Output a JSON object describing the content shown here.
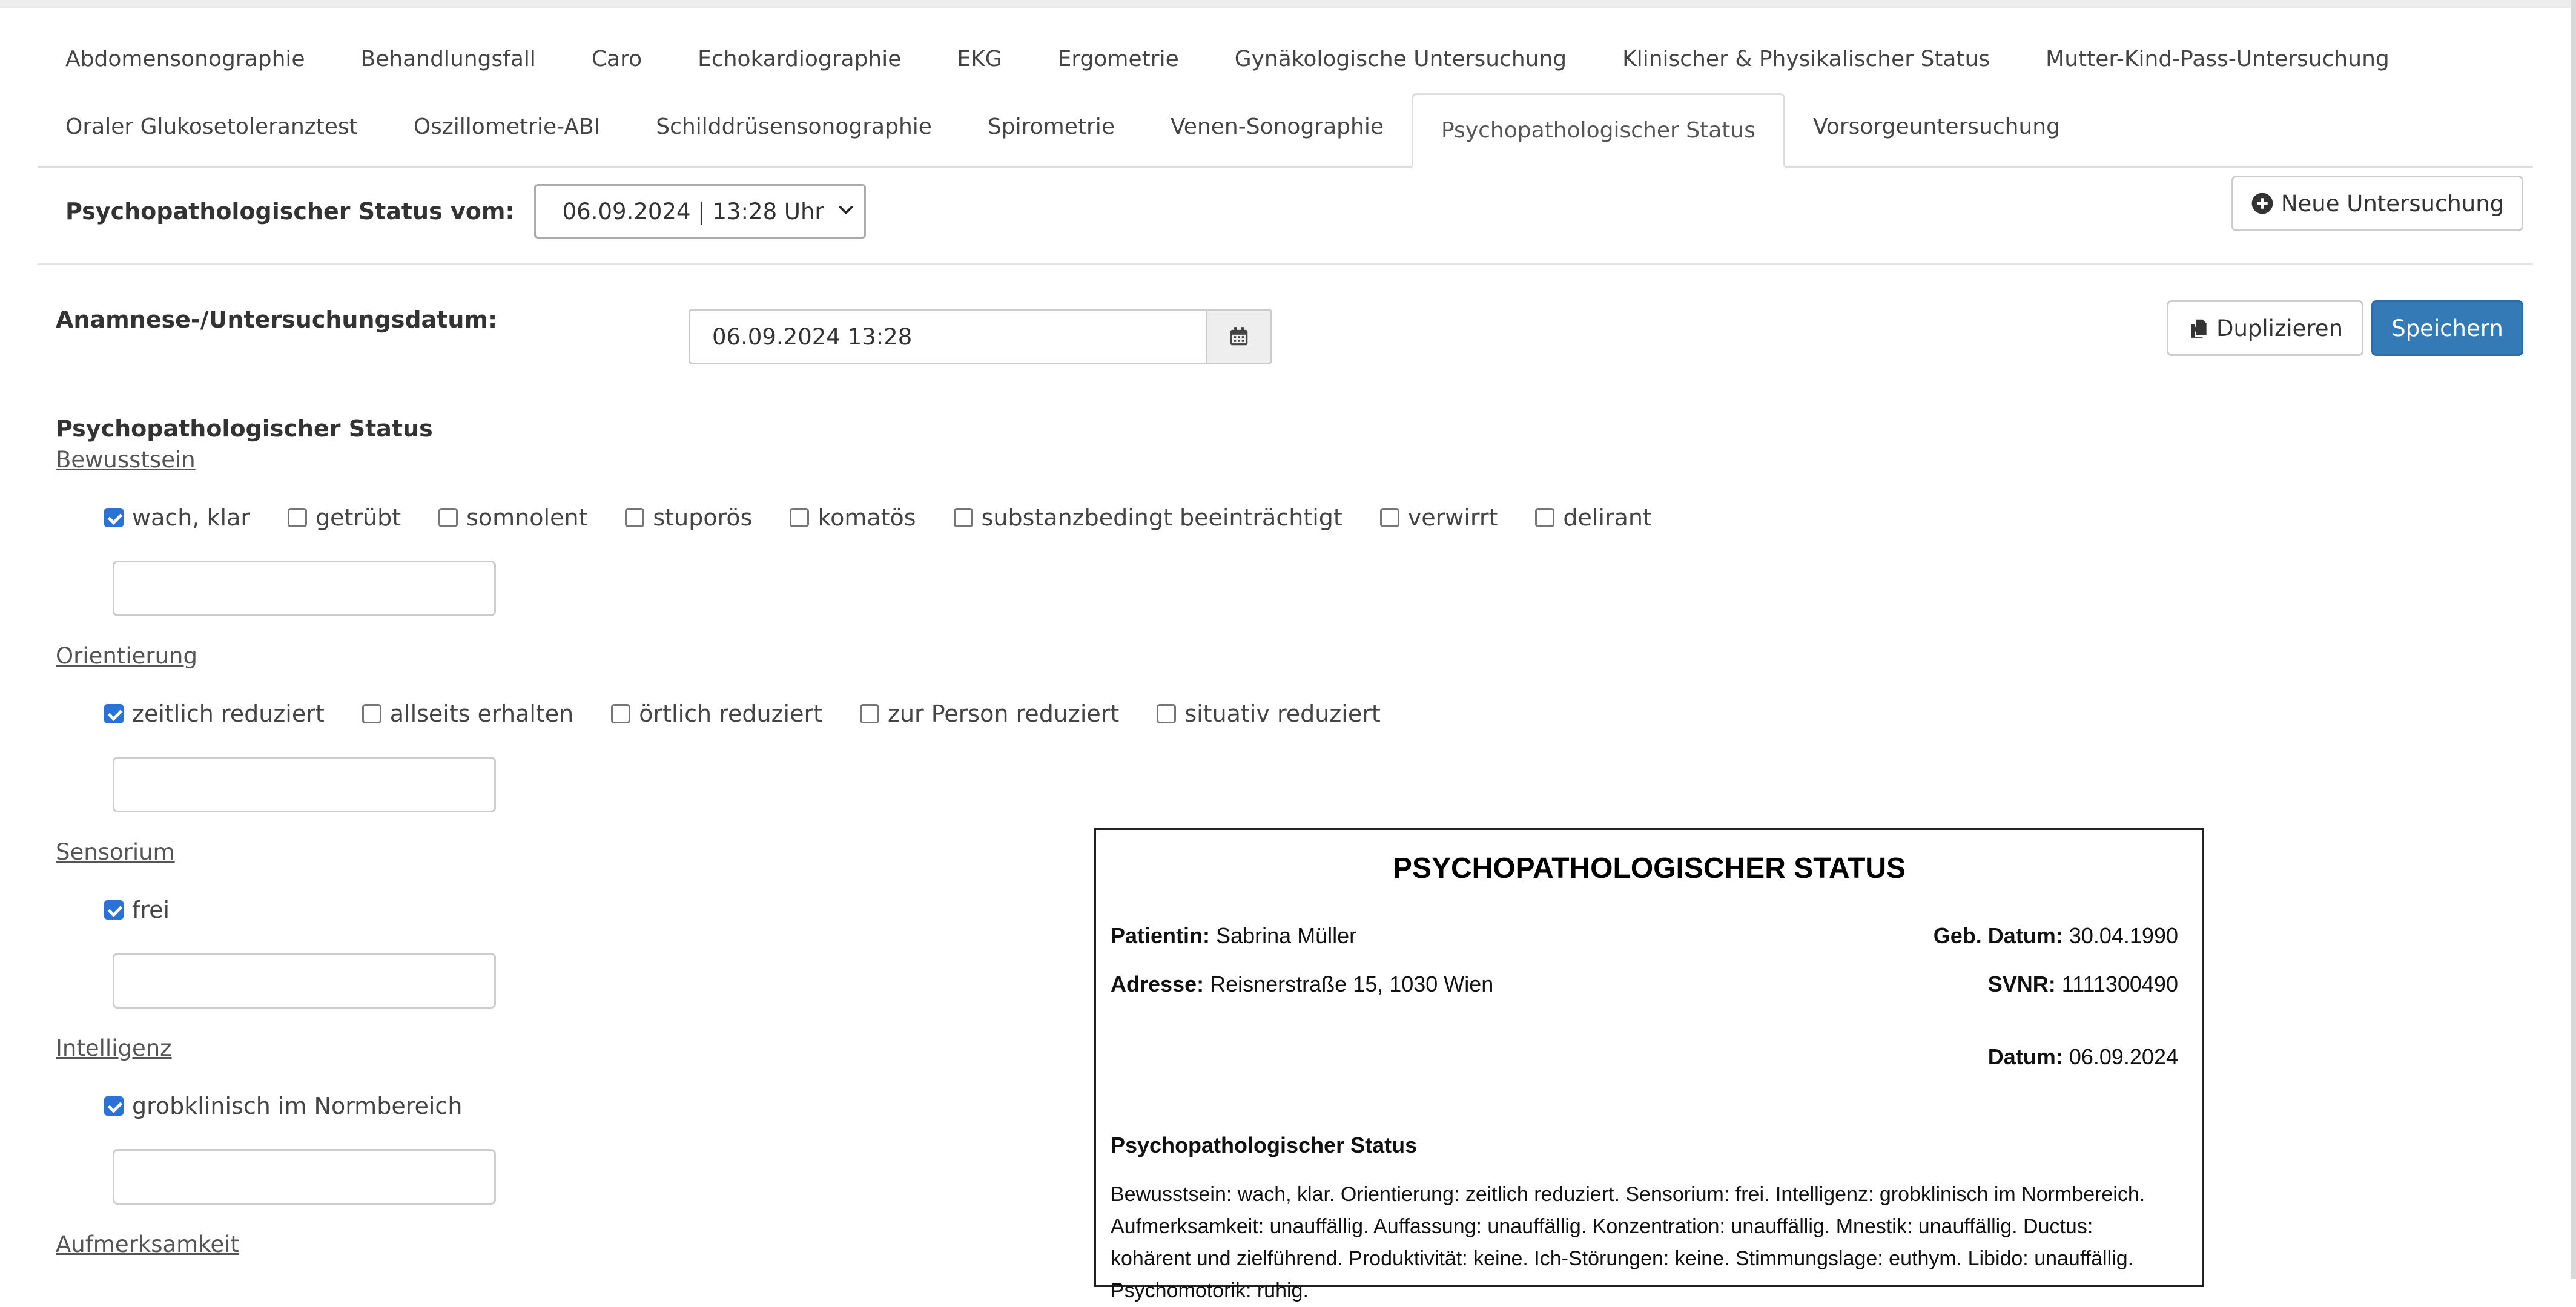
{
  "tabs": {
    "row1": [
      "Abdomensonographie",
      "Behandlungsfall",
      "Caro",
      "Echokardiographie",
      "EKG",
      "Ergometrie",
      "Gynäkologische Untersuchung",
      "Klinischer & Physikalischer Status",
      "Mutter-Kind-Pass-Untersuchung"
    ],
    "row2": [
      "Oraler Glukosetoleranztest",
      "Oszillometrie-ABI",
      "Schilddrüsensonographie",
      "Spirometrie",
      "Venen-Sonographie",
      "Psychopathologischer Status",
      "Vorsorgeuntersuchung"
    ],
    "active": "Psychopathologischer Status"
  },
  "status_select": {
    "label": "Psychopathologischer Status vom:",
    "value": "06.09.2024 | 13:28 Uhr"
  },
  "buttons": {
    "new_exam": "Neue Untersuchung",
    "duplicate": "Duplizieren",
    "save": "Speichern"
  },
  "exam_date": {
    "label": "Anamnese-/Untersuchungsdatum:",
    "value": "06.09.2024 13:28"
  },
  "form": {
    "section_title": "Psychopathologischer Status",
    "groups": [
      {
        "label": "Bewusstsein",
        "options": [
          {
            "label": "wach, klar",
            "checked": true
          },
          {
            "label": "getrübt",
            "checked": false
          },
          {
            "label": "somnolent",
            "checked": false
          },
          {
            "label": "stuporös",
            "checked": false
          },
          {
            "label": "komatös",
            "checked": false
          },
          {
            "label": "substanzbedingt beeinträchtigt",
            "checked": false
          },
          {
            "label": "verwirrt",
            "checked": false
          },
          {
            "label": "delirant",
            "checked": false
          }
        ],
        "note": ""
      },
      {
        "label": "Orientierung",
        "options": [
          {
            "label": "zeitlich reduziert",
            "checked": true
          },
          {
            "label": "allseits erhalten",
            "checked": false
          },
          {
            "label": "örtlich reduziert",
            "checked": false
          },
          {
            "label": "zur Person reduziert",
            "checked": false
          },
          {
            "label": "situativ reduziert",
            "checked": false
          }
        ],
        "note": ""
      },
      {
        "label": "Sensorium",
        "options": [
          {
            "label": "frei",
            "checked": true
          }
        ],
        "note": ""
      },
      {
        "label": "Intelligenz",
        "options": [
          {
            "label": "grobklinisch im Normbereich",
            "checked": true
          }
        ],
        "note": ""
      },
      {
        "label": "Aufmerksamkeit",
        "options": [],
        "note": ""
      }
    ]
  },
  "report": {
    "title": "PSYCHOPATHOLOGISCHER STATUS",
    "patient_label": "Patientin:",
    "patient_name": "Sabrina Müller",
    "dob_label": "Geb. Datum:",
    "dob": "30.04.1990",
    "address_label": "Adresse:",
    "address": "Reisnerstraße 15, 1030 Wien",
    "svnr_label": "SVNR:",
    "svnr": "1111300490",
    "date_label": "Datum:",
    "date": "06.09.2024",
    "section_title": "Psychopathologischer Status",
    "body": "Bewusstsein: wach, klar. Orientierung: zeitlich reduziert. Sensorium: frei. Intelligenz: grobklinisch im Normbereich. Aufmerksamkeit: unauffällig. Auffassung: unauffällig. Konzentration: unauffällig. Mnestik: unauffällig. Ductus: kohärent und zielführend. Produktivität: keine. Ich-Störungen: keine. Stimmungslage: euthym. Libido: unauffällig. Psychomotorik: ruhig."
  },
  "colors": {
    "primary": "#337ab7",
    "checkbox": "#2b72d6",
    "border": "#cccccc"
  }
}
